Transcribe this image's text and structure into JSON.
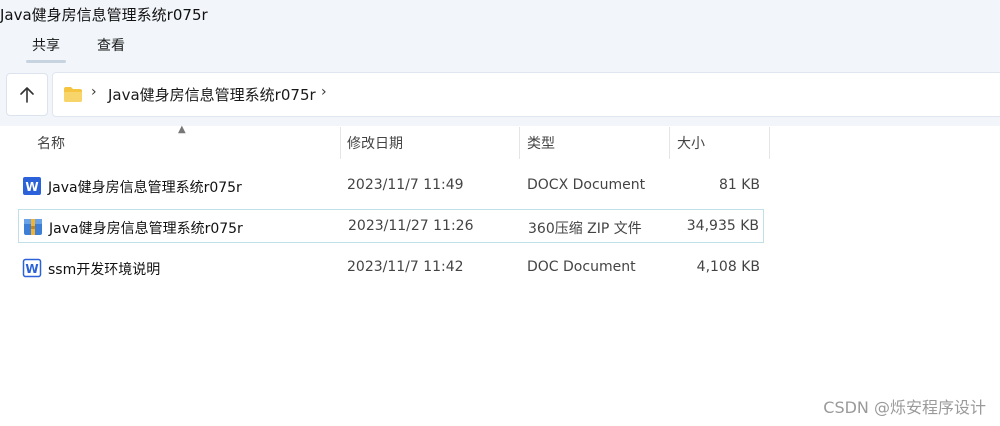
{
  "window": {
    "title": "Java健身房信息管理系统r075r"
  },
  "ribbon": {
    "tabs": [
      {
        "label": "共享"
      },
      {
        "label": "查看"
      }
    ]
  },
  "address_bar": {
    "path": "Java健身房信息管理系统r075r",
    "separator": "›"
  },
  "columns": {
    "name": "名称",
    "date": "修改日期",
    "type": "类型",
    "size": "大小"
  },
  "files": [
    {
      "name": "Java健身房信息管理系统r075r",
      "modified": "2023/11/7 11:49",
      "type": "DOCX Document",
      "size": "81 KB",
      "icon": "word-doc-icon"
    },
    {
      "name": "Java健身房信息管理系统r075r",
      "modified": "2023/11/27 11:26",
      "type": "360压缩 ZIP 文件",
      "size": "34,935 KB",
      "icon": "zip-archive-icon"
    },
    {
      "name": "ssm开发环境说明",
      "modified": "2023/11/7 11:42",
      "type": "DOC Document",
      "size": "4,108 KB",
      "icon": "word-doc-outline-icon"
    }
  ],
  "watermark": "CSDN @烁安程序设计",
  "colors": {
    "band": "#f2f6fb",
    "selection_border": "#bfe0e6",
    "word_blue": "#2b62d9",
    "folder_yellow": "#f5c542"
  }
}
